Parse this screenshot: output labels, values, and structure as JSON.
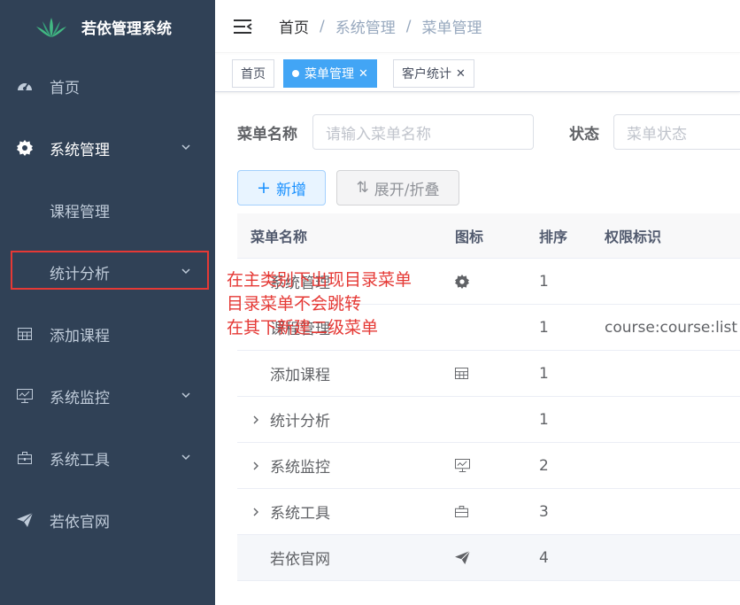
{
  "app": {
    "title": "若依管理系统"
  },
  "sidebar": {
    "items": [
      {
        "label": "首页",
        "icon": "dashboard-icon"
      },
      {
        "label": "系统管理",
        "icon": "gear-icon",
        "arrow": true
      },
      {
        "label": "课程管理"
      },
      {
        "label": "统计分析",
        "arrow": true
      },
      {
        "label": "添加课程",
        "icon": "table-icon"
      },
      {
        "label": "系统监控",
        "icon": "monitor-icon",
        "arrow": true
      },
      {
        "label": "系统工具",
        "icon": "toolbox-icon",
        "arrow": true
      },
      {
        "label": "若依官网",
        "icon": "send-icon"
      }
    ]
  },
  "breadcrumb": [
    "首页",
    "系统管理",
    "菜单管理"
  ],
  "tags": [
    {
      "label": "首页"
    },
    {
      "label": "菜单管理",
      "active": true
    },
    {
      "label": "客户统计"
    }
  ],
  "search": {
    "name_label": "菜单名称",
    "name_placeholder": "请输入菜单名称",
    "status_label": "状态",
    "status_placeholder": "菜单状态"
  },
  "buttons": {
    "add": "新增",
    "toggle": "展开/折叠",
    "add_icon": "+",
    "toggle_icon": "⇅"
  },
  "table": {
    "headers": [
      "菜单名称",
      "图标",
      "排序",
      "权限标识"
    ],
    "rows": [
      {
        "name": "系统管理",
        "icon": "gear-icon",
        "sort": "1",
        "perm": "",
        "expandable": false
      },
      {
        "name": "课程管理",
        "icon": "",
        "sort": "1",
        "perm": "course:course:list",
        "expandable": false
      },
      {
        "name": "添加课程",
        "icon": "table-icon",
        "sort": "1",
        "perm": "",
        "expandable": false
      },
      {
        "name": "统计分析",
        "icon": "",
        "sort": "1",
        "perm": "",
        "expandable": true
      },
      {
        "name": "系统监控",
        "icon": "monitor-icon",
        "sort": "2",
        "perm": "",
        "expandable": true
      },
      {
        "name": "系统工具",
        "icon": "toolbox-icon",
        "sort": "3",
        "perm": "",
        "expandable": true
      },
      {
        "name": "若依官网",
        "icon": "send-icon",
        "sort": "4",
        "perm": "",
        "expandable": false
      }
    ]
  },
  "annotation": {
    "lines": [
      "在主类别下出现目录菜单",
      "目录菜单不会跳转",
      "在其下新建二级菜单"
    ]
  },
  "colors": {
    "sidebar_bg": "#304156",
    "accent": "#42a5f5",
    "annotation": "#e53935"
  }
}
